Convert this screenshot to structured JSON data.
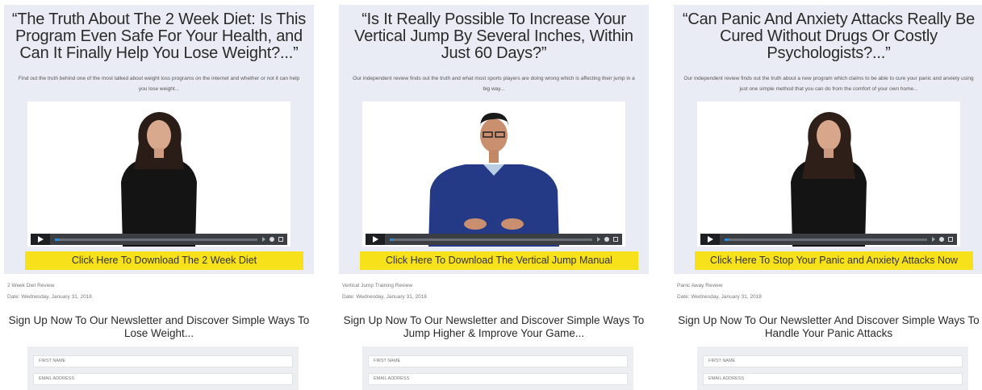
{
  "panels": [
    {
      "headline": "“The Truth About The 2 Week Diet: Is This Program Even Safe For Your Health, and Can It Finally Help You Lose Weight?...”",
      "subtext": "Find out the truth behind one of the most talked about weight loss programs on the internet and whether or not it can help you lose weight...",
      "video_progress": 0.02,
      "cta": "Click Here To Download The 2 Week Diet",
      "review_title": "2 Week Diet Review",
      "review_date": "Date: Wednesday, January 31, 2018",
      "signup_heading": "Sign Up Now To Our Newsletter and Discover Simple Ways To Lose Weight...",
      "first_name_placeholder": "FIRST NAME",
      "email_placeholder": "EMAIL ADDRESS"
    },
    {
      "headline": "“Is It Really Possible To Increase Your Vertical Jump By Several Inches, Within Just 60 Days?”",
      "subtext": "Our independent review finds out the truth and what most sports players are doing wrong which is affecting their jump in a big way...",
      "video_progress": 0.02,
      "cta": "Click Here To Download The Vertical Jump Manual",
      "review_title": "Vertical Jump Training Review",
      "review_date": "Date: Wednesday, January 31, 2018",
      "signup_heading": "Sign Up Now To Our Newsletter and Discover Simple Ways To Jump Higher & Improve Your Game...",
      "first_name_placeholder": "FIRST NAME",
      "email_placeholder": "EMAIL ADDRESS"
    },
    {
      "headline": "“Can Panic And Anxiety Attacks Really Be Cured Without Drugs Or Costly Psychologists?...”",
      "subtext": "Our independent review finds out the truth about a new program which claims to be able to cure your panic and anxiety using just one simple method that you can do from the comfort of your own home...",
      "video_progress": 0.02,
      "cta": "Click Here To Stop Your Panic and Anxiety Attacks Now",
      "review_title": "Panic Away Review",
      "review_date": "Date: Wednesday, January 31, 2018",
      "signup_heading": "Sign Up Now To Our Newsletter And Discover Simple Ways To Handle Your Panic Attacks",
      "first_name_placeholder": "FIRST NAME",
      "email_placeholder": "EMAIL ADDRESS"
    }
  ],
  "colors": {
    "hero_bg": "#e9ecf4",
    "cta_bg": "#f7e11b",
    "progress": "#2e8bd6"
  }
}
